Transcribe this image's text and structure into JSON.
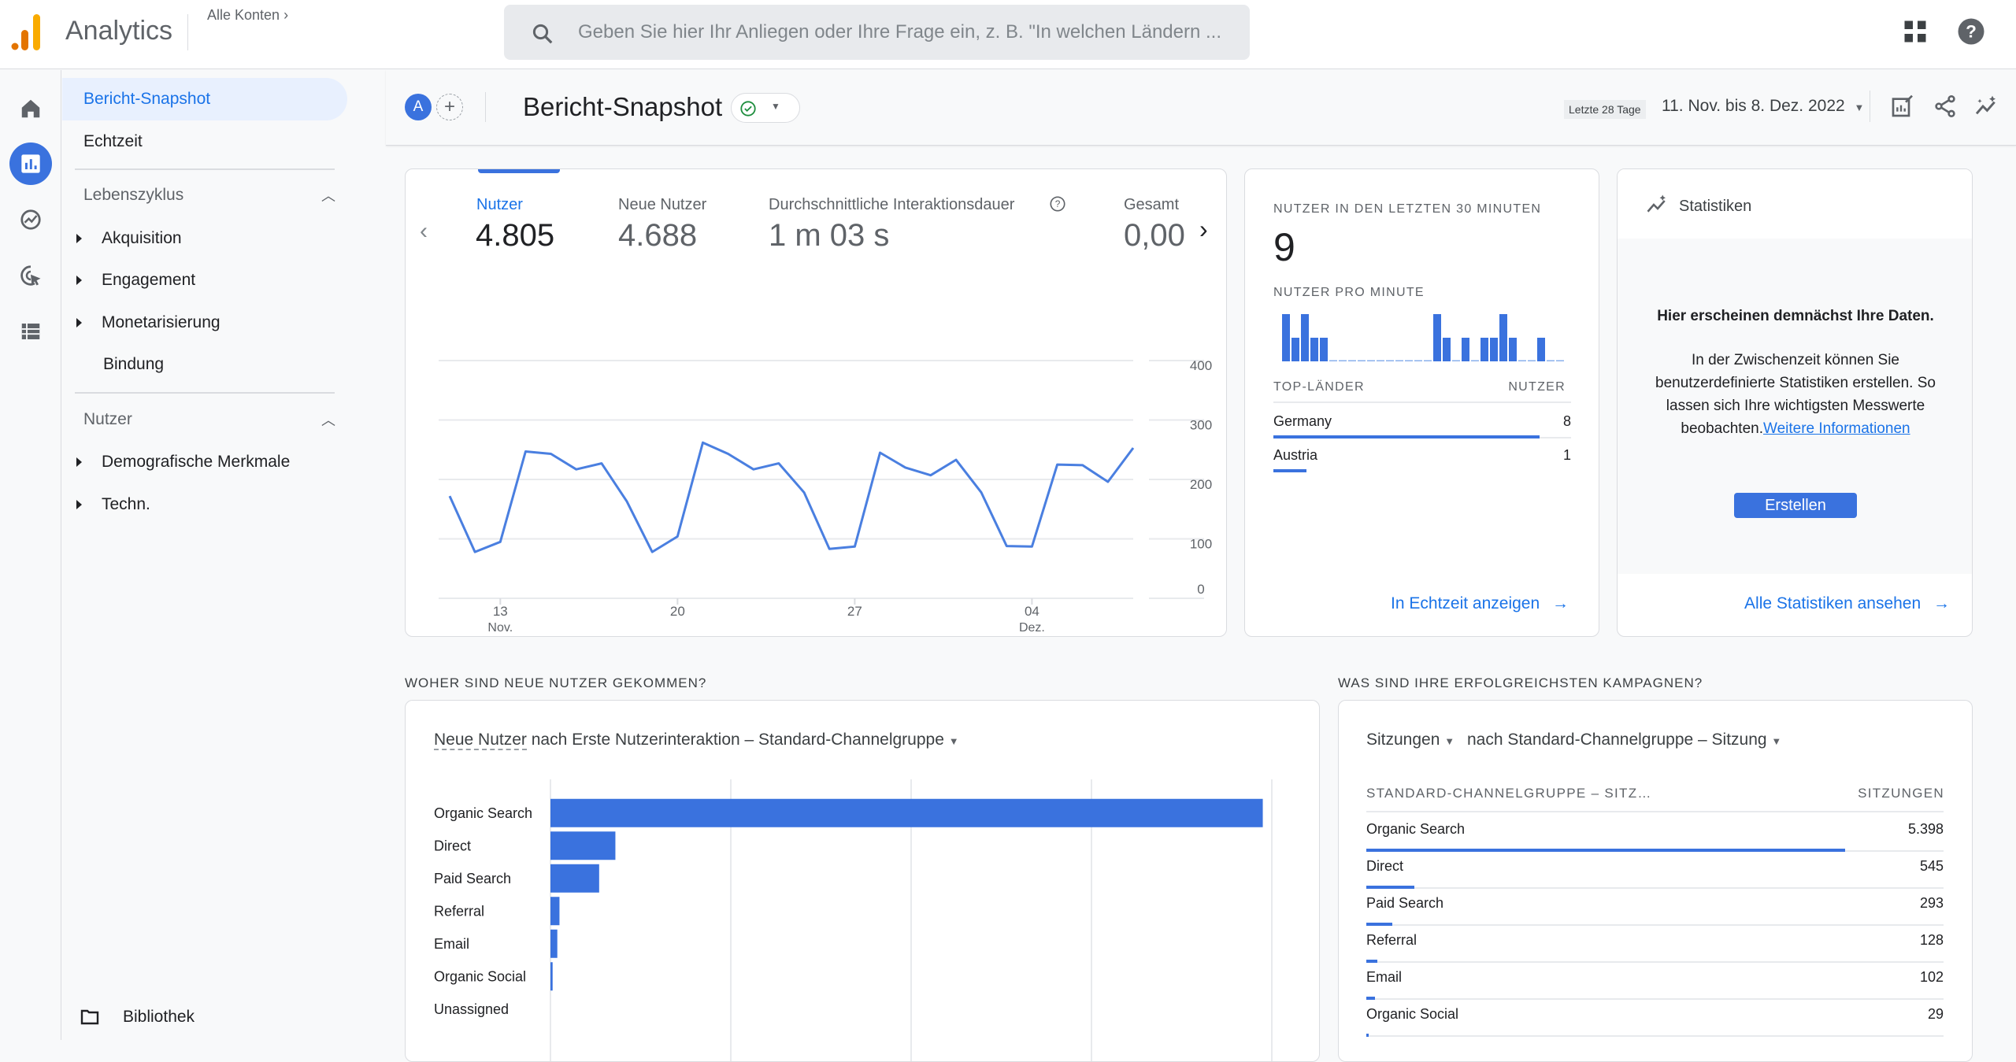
{
  "topbar": {
    "app_name": "Analytics",
    "accounts_label": "Alle Konten",
    "search_placeholder": "Geben Sie hier Ihr Anliegen oder Ihre Frage ein, z. B. \"In welchen Ländern ...",
    "icons": [
      "apps-grid-icon",
      "help-icon"
    ]
  },
  "rail": {
    "items": [
      "home-icon",
      "reports-icon",
      "explore-icon",
      "advertising-icon",
      "configure-icon"
    ],
    "active": "reports-icon"
  },
  "nav": {
    "items": [
      {
        "label": "Bericht-Snapshot",
        "selected": true
      },
      {
        "label": "Echtzeit"
      }
    ],
    "sections": [
      {
        "title": "Lebenszyklus",
        "items": [
          {
            "label": "Akquisition",
            "expandable": true
          },
          {
            "label": "Engagement",
            "expandable": true
          },
          {
            "label": "Monetarisierung",
            "expandable": true
          },
          {
            "label": "Bindung",
            "expandable": false
          }
        ]
      },
      {
        "title": "Nutzer",
        "items": [
          {
            "label": "Demografische Merkmale",
            "expandable": true
          },
          {
            "label": "Techn.",
            "expandable": true
          }
        ]
      }
    ],
    "library_label": "Bibliothek"
  },
  "subbar": {
    "avatar_letter": "A",
    "title": "Bericht-Snapshot",
    "date_chip": "Letzte 28 Tage",
    "date_range": "11. Nov. bis 8. Dez. 2022"
  },
  "kpis": [
    {
      "label": "Nutzer",
      "value": "4.805",
      "active": true
    },
    {
      "label": "Neue Nutzer",
      "value": "4.688"
    },
    {
      "label": "Durchschnittliche Interaktionsdauer",
      "value": "1 m 03 s"
    },
    {
      "label": "Gesamt",
      "value": "0,00"
    }
  ],
  "realtime": {
    "title": "Nutzer in den letzten 30 Minuten",
    "value": "9",
    "per_minute_title": "Nutzer pro Minute",
    "per_minute": [
      2,
      1,
      2,
      1,
      1,
      0,
      0,
      0,
      0,
      0,
      0,
      0,
      0,
      0,
      0,
      0,
      2,
      1,
      0,
      1,
      0,
      1,
      1,
      2,
      1,
      0,
      0,
      1,
      0,
      0
    ],
    "countries_header": "Top-Länder",
    "users_header": "Nutzer",
    "countries": [
      {
        "name": "Germany",
        "value": 8
      },
      {
        "name": "Austria",
        "value": 1
      }
    ],
    "link": "In Echtzeit anzeigen"
  },
  "insights": {
    "title": "Statistiken",
    "headline": "Hier erscheinen demnächst Ihre Daten.",
    "body": "In der Zwischenzeit können Sie benutzerdefinierte Statistiken erstellen. So lassen sich Ihre wichtigsten Messwerte beobachten.",
    "more_link": "Weitere Informationen",
    "create_button": "Erstellen",
    "all_link": "Alle Statistiken ansehen"
  },
  "new_users_section": {
    "title": "WOHER SIND NEUE NUTZER GEKOMMEN?",
    "metric": "Neue Nutzer",
    "dimension": "nach Erste Nutzerinteraktion – Standard-Channelgruppe"
  },
  "campaigns_section": {
    "title": "WAS SIND IHRE ERFOLGREICHSTEN KAMPAGNEN?",
    "metric": "Sitzungen",
    "dimension": "nach Standard-Channelgruppe – Sitzung",
    "col_dim": "STANDARD-CHANNELGRUPPE – SITZ…",
    "col_metric": "SITZUNGEN",
    "rows": [
      {
        "name": "Organic Search",
        "value": "5.398",
        "num": 5398
      },
      {
        "name": "Direct",
        "value": "545",
        "num": 545
      },
      {
        "name": "Paid Search",
        "value": "293",
        "num": 293
      },
      {
        "name": "Referral",
        "value": "128",
        "num": 128
      },
      {
        "name": "Email",
        "value": "102",
        "num": 102
      },
      {
        "name": "Organic Social",
        "value": "29",
        "num": 29
      }
    ]
  },
  "chart_data": [
    {
      "type": "line",
      "title": "Nutzer",
      "x": [
        "11",
        "12",
        "13",
        "14",
        "15",
        "16",
        "17",
        "18",
        "19",
        "20",
        "21",
        "22",
        "23",
        "24",
        "25",
        "26",
        "27",
        "28",
        "29",
        "30",
        "01",
        "02",
        "03",
        "04",
        "05",
        "06",
        "07",
        "08"
      ],
      "x_ticks": [
        {
          "label": "13",
          "sub": "Nov.",
          "index": 2
        },
        {
          "label": "20",
          "sub": "",
          "index": 9
        },
        {
          "label": "27",
          "sub": "",
          "index": 16
        },
        {
          "label": "04",
          "sub": "Dez.",
          "index": 23
        }
      ],
      "series": [
        {
          "name": "Nutzer",
          "values": [
            172,
            78,
            95,
            247,
            243,
            217,
            227,
            163,
            78,
            104,
            262,
            243,
            217,
            227,
            178,
            83,
            87,
            245,
            220,
            207,
            233,
            178,
            88,
            87,
            225,
            224,
            196,
            253
          ]
        }
      ],
      "y_ticks": [
        0,
        100,
        200,
        300,
        400
      ],
      "ylim": [
        0,
        400
      ],
      "grid": true,
      "color": "#4a7fe0"
    },
    {
      "type": "bar",
      "orientation": "horizontal",
      "title": "Neue Nutzer nach Erste Nutzerinteraktion – Standard-Channelgruppe",
      "categories": [
        "Organic Search",
        "Direct",
        "Paid Search",
        "Referral",
        "Email",
        "Organic Social",
        "Unassigned"
      ],
      "values": [
        3950,
        360,
        270,
        50,
        38,
        12,
        0
      ],
      "xlim": [
        0,
        4000
      ],
      "grid": true,
      "color": "#3a72de"
    }
  ]
}
